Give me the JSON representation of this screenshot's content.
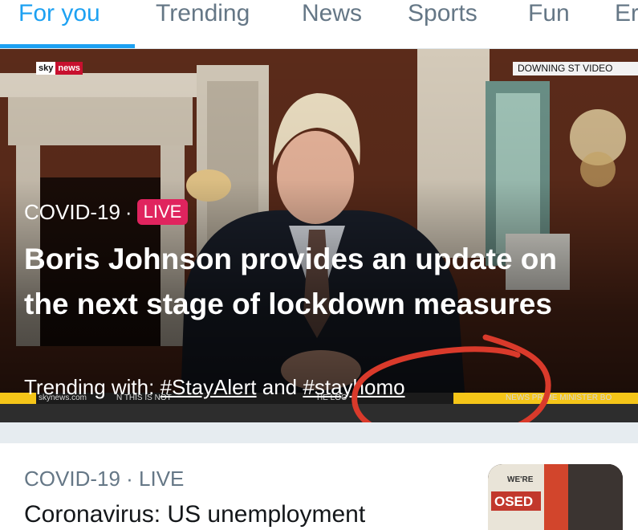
{
  "tabs": [
    {
      "label": "For you",
      "active": true
    },
    {
      "label": "Trending",
      "active": false
    },
    {
      "label": "News",
      "active": false
    },
    {
      "label": "Sports",
      "active": false
    },
    {
      "label": "Fun",
      "active": false
    },
    {
      "label": "Er",
      "active": false
    }
  ],
  "hero": {
    "logo": {
      "sky": "sky",
      "news": "news"
    },
    "video_badge": "DOWNING ST VIDEO",
    "category": "COVID-19",
    "separator": "·",
    "live_label": "LIVE",
    "headline": "Boris Johnson provides an update on the next stage of lockdown measures",
    "trending_prefix": "Trending with:",
    "trending_tag_1": "#StayAlert",
    "trending_and": "and",
    "trending_tag_2": "#stayhomo",
    "ticker": {
      "left": "skynews.com",
      "middle": "N  THIS IS NOT",
      "middle2": "HE LOC",
      "right": "NEWS  PRIME MINISTER BO"
    }
  },
  "card2": {
    "category": "COVID-19 · LIVE",
    "headline": "Coronavirus: US unemployment",
    "thumb_text_1": "WE'RE",
    "thumb_text_2": "OSED"
  },
  "colors": {
    "accent": "#1da1f2",
    "live": "#e0245e",
    "annotation": "#d93a2b"
  }
}
